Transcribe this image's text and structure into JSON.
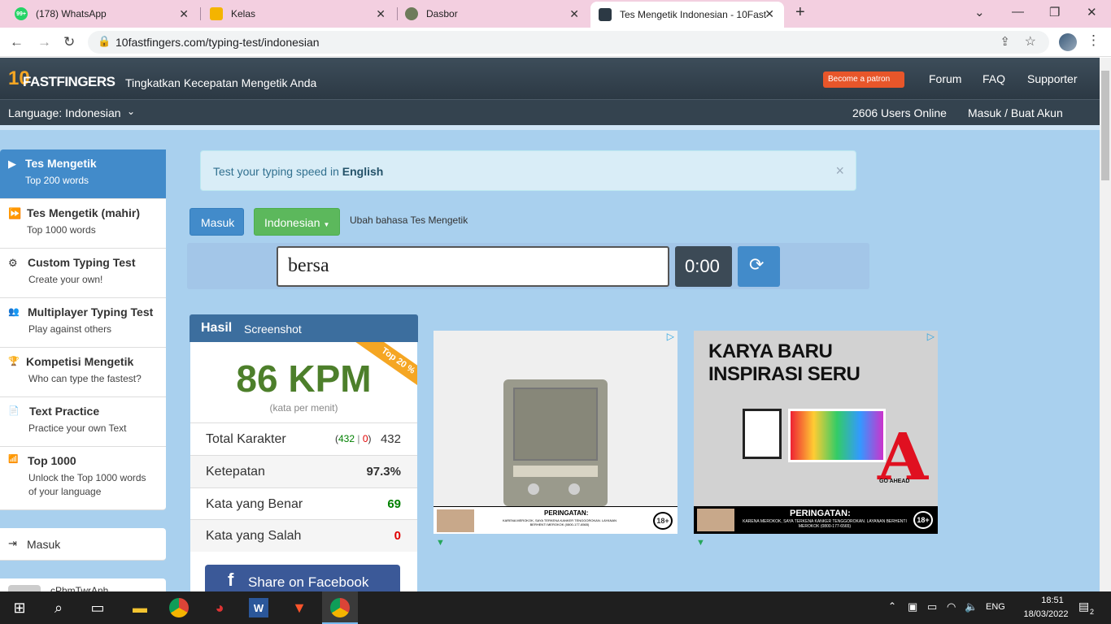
{
  "browser": {
    "tabs": [
      {
        "label": "(178) WhatsApp",
        "badge": "99+"
      },
      {
        "label": "Kelas"
      },
      {
        "label": "Dasbor"
      },
      {
        "label": "Tes Mengetik Indonesian - 10Fast"
      }
    ],
    "new_tab": "+",
    "url": "10fastfingers.com/typing-test/indonesian"
  },
  "site": {
    "logo_text": "FASTFINGERS",
    "logo_num": "10",
    "tagline": "Tingkatkan Kecepatan Mengetik Anda",
    "patron": "Become a patron",
    "nav": [
      "Forum",
      "FAQ",
      "Supporter"
    ],
    "language": "Language: Indonesian",
    "users_online": "2606 Users Online",
    "login": "Masuk / Buat Akun"
  },
  "sidebar": {
    "items": [
      {
        "title": "Tes Mengetik",
        "sub": "Top 200 words",
        "icon": "▶"
      },
      {
        "title": "Tes Mengetik (mahir)",
        "sub": "Top 1000 words",
        "icon": "⏩"
      },
      {
        "title": "Custom Typing Test",
        "sub": "Create your own!",
        "icon": "⚙"
      },
      {
        "title": "Multiplayer Typing Test",
        "sub": "Play against others",
        "icon": "👥"
      },
      {
        "title": "Kompetisi Mengetik",
        "sub": "Who can type the fastest?",
        "icon": "🏆"
      },
      {
        "title": "Text Practice",
        "sub": "Practice your own Text",
        "icon": "📄"
      },
      {
        "title": "Top 1000",
        "sub": "Unlock the Top 1000 words",
        "sub2": "of your language",
        "icon": "📶"
      }
    ],
    "masuk": "Masuk",
    "user_partial": "cPhmTwrAnh"
  },
  "main": {
    "alert_text": "Test your typing speed in ",
    "alert_link": "English",
    "alert_close": "×",
    "btn_masuk": "Masuk",
    "btn_lang": "Indonesian",
    "change_lang": "Ubah bahasa Tes Mengetik",
    "input_value": "bersa",
    "timer": "0:00",
    "results": {
      "tab_hasil": "Hasil",
      "tab_screenshot": "Screenshot",
      "ribbon": "Top 20 %",
      "wpm": "86 KPM",
      "wpm_sub": "(kata per menit)",
      "rows": [
        {
          "label": "Total Karakter",
          "detail_ok": "432",
          "detail_sep": " | ",
          "detail_err": "0",
          "value": "432",
          "color": "#333333"
        },
        {
          "label": "Ketepatan",
          "value": "97.3%",
          "color": "#333333"
        },
        {
          "label": "Kata yang Benar",
          "value": "69",
          "color": "#008000"
        },
        {
          "label": "Kata yang Salah",
          "value": "0",
          "color": "#e00000"
        }
      ],
      "share": "Share on Facebook"
    },
    "ads": [
      {
        "warning_title": "PERINGATAN:",
        "warning_text": "KARENA MEROKOK, SAYA TERKENA KANKER TENGGOROKAN. LAYANAN BERHENTI MEROKOK (0800-177-6565)",
        "age": "18+"
      },
      {
        "headline1": "KARYA BARU",
        "headline2": "INSPIRASI SERU",
        "warning_title": "PERINGATAN:",
        "warning_text": "KARENA MEROKOK, SAYA TERKENA KANKER TENGGOROKAN. LAYANAN BERHENTI MEROKOK (0800-177-6565)",
        "age": "18+",
        "brand": "GO AHEAD"
      }
    ]
  },
  "taskbar": {
    "lang": "ENG",
    "time": "18:51",
    "date": "18/03/2022",
    "notif": "2"
  },
  "colors": {
    "accent": "#428bca",
    "green_btn": "#5cb85c",
    "header": "#34434f",
    "bg": "#a9d0ee",
    "wpm": "#4d7f2b"
  }
}
